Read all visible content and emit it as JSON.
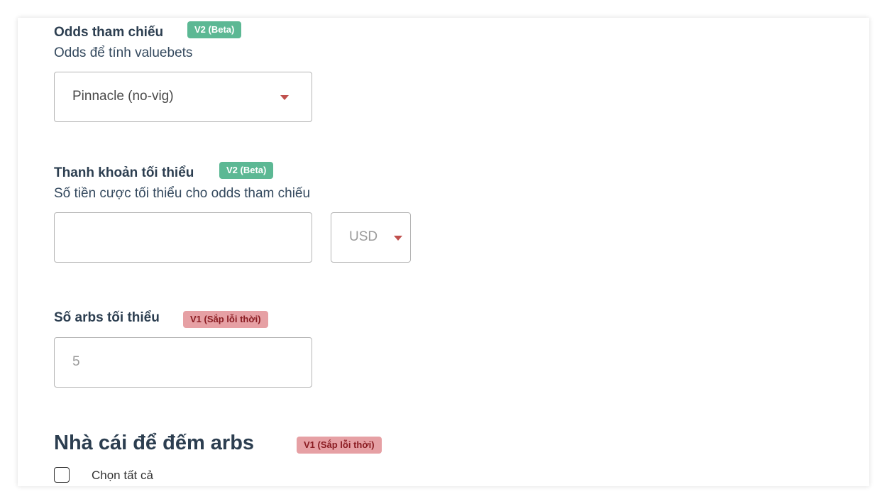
{
  "reference_odds": {
    "label": "Odds tham chiếu",
    "badge": "V2 (Beta)",
    "description": "Odds để tính valuebets",
    "select_value": "Pinnacle (no-vig)"
  },
  "min_liquidity": {
    "label": "Thanh khoản tối thiểu",
    "badge": "V2 (Beta)",
    "description": "Số tiền cược tối thiểu cho odds tham chiếu",
    "amount_value": "",
    "currency_value": "USD"
  },
  "min_arbs": {
    "label": "Số arbs tối thiểu",
    "badge": "V1 (Sắp lỗi thời)",
    "placeholder": "5"
  },
  "bookmakers_section": {
    "title": "Nhà cái để đếm arbs",
    "badge": "V1 (Sắp lỗi thời)",
    "select_all_label": "Chọn tất cả",
    "select_all_checked": false
  },
  "colors": {
    "badge_v2": "#5cb894",
    "badge_v1_bg": "#e6a0a4",
    "badge_v1_text": "#8a1c22",
    "caret": "#c0504d",
    "heading": "#2c3e50"
  },
  "icons": {
    "dropdown": "caret-down-icon",
    "checkbox": "checkbox-icon"
  }
}
